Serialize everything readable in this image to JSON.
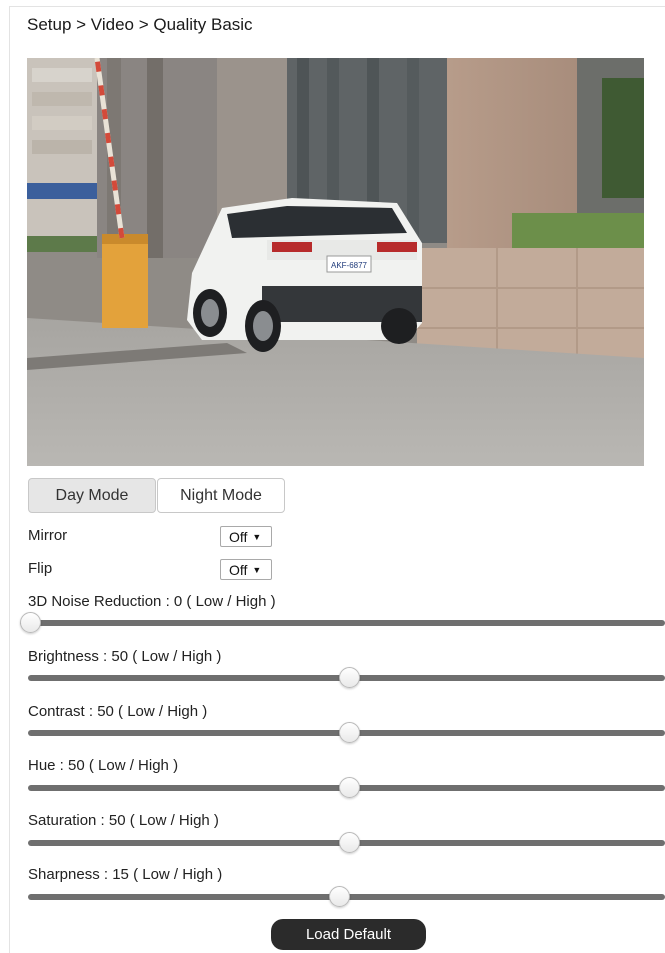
{
  "breadcrumb": "Setup > Video > Quality Basic",
  "video": {
    "plate": "AKF-6877"
  },
  "mode_tabs": {
    "day": "Day Mode",
    "night": "Night Mode",
    "active": "day"
  },
  "mirror": {
    "label": "Mirror",
    "value": "Off"
  },
  "flip": {
    "label": "Flip",
    "value": "Off"
  },
  "sliders": [
    {
      "label": "3D Noise Reduction : 0 ( Low / High )",
      "value": 0
    },
    {
      "label": "Brightness : 50 ( Low / High )",
      "value": 50
    },
    {
      "label": "Contrast : 50 ( Low / High )",
      "value": 50
    },
    {
      "label": "Hue : 50 ( Low / High )",
      "value": 50
    },
    {
      "label": "Saturation : 50 ( Low / High )",
      "value": 50
    },
    {
      "label": "Sharpness : 15 ( Low / High )",
      "value": 15
    }
  ],
  "load_default": "Load Default",
  "caret_icon": "▼"
}
